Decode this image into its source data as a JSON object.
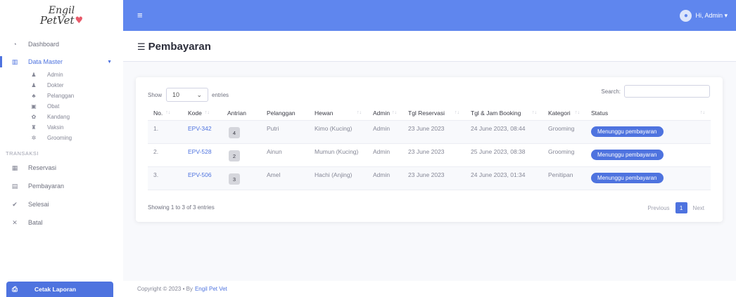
{
  "brand": {
    "line1": "Engil",
    "line2": "PetVet"
  },
  "sidebar": {
    "dashboard": "Dashboard",
    "data_master": "Data Master",
    "sub_items": [
      {
        "icon": "user-icon",
        "glyph": "♟",
        "label": "Admin"
      },
      {
        "icon": "user-doctor-icon",
        "glyph": "♟",
        "label": "Dokter"
      },
      {
        "icon": "users-icon",
        "glyph": "♣",
        "label": "Pelanggan"
      },
      {
        "icon": "pills-icon",
        "glyph": "▣",
        "label": "Obat"
      },
      {
        "icon": "paw-icon",
        "glyph": "✿",
        "label": "Kandang"
      },
      {
        "icon": "syringe-icon",
        "glyph": "♜",
        "label": "Vaksin"
      },
      {
        "icon": "grooming-icon",
        "glyph": "✲",
        "label": "Grooming"
      }
    ],
    "section_transaksi": "TRANSAKSI",
    "transaksi_items": [
      {
        "icon": "grid-icon",
        "glyph": "▦",
        "label": "Reservasi"
      },
      {
        "icon": "database-icon",
        "glyph": "▤",
        "label": "Pembayaran"
      },
      {
        "icon": "check-icon",
        "glyph": "✔",
        "label": "Selesai"
      },
      {
        "icon": "times-icon",
        "glyph": "✕",
        "label": "Batal"
      }
    ],
    "cetak_label": "Cetak Laporan"
  },
  "topbar": {
    "user_label": "Hi, Admin ▾"
  },
  "page": {
    "title": "Pembayaran"
  },
  "table_controls": {
    "show_label": "Show",
    "entries_value": "10",
    "entries_label": "entries",
    "search_label": "Search:"
  },
  "table": {
    "headers": [
      "No.",
      "Kode",
      "Antrian",
      "Pelanggan",
      "Hewan",
      "Admin",
      "Tgl Reservasi",
      "Tgl & Jam Booking",
      "Kategori",
      "Status"
    ],
    "rows": [
      {
        "no": "1.",
        "kode": "EPV-342",
        "antrian": "4",
        "pelanggan": "Putri",
        "hewan": "Kimo (Kucing)",
        "admin": "Admin",
        "tgl_reservasi": "23 June 2023",
        "booking": "24 June 2023, 08:44",
        "kategori": "Grooming",
        "status": "Menunggu pembayaran"
      },
      {
        "no": "2.",
        "kode": "EPV-528",
        "antrian": "2",
        "pelanggan": "Ainun",
        "hewan": "Mumun (Kucing)",
        "admin": "Admin",
        "tgl_reservasi": "23 June 2023",
        "booking": "25 June 2023, 08:38",
        "kategori": "Grooming",
        "status": "Menunggu pembayaran"
      },
      {
        "no": "3.",
        "kode": "EPV-506",
        "antrian": "3",
        "pelanggan": "Amel",
        "hewan": "Hachi (Anjing)",
        "admin": "Admin",
        "tgl_reservasi": "23 June 2023",
        "booking": "24 June 2023, 01:34",
        "kategori": "Penitipan",
        "status": "Menunggu pembayaran"
      }
    ]
  },
  "pagination": {
    "info": "Showing 1 to 3 of 3 entries",
    "previous": "Previous",
    "current": "1",
    "next": "Next"
  },
  "footer": {
    "copyright": "Copyright © 2023 •  By",
    "brand": "Engil Pet Vet"
  },
  "colors": {
    "primary": "#4e73df",
    "topbar": "#5f86ee"
  }
}
